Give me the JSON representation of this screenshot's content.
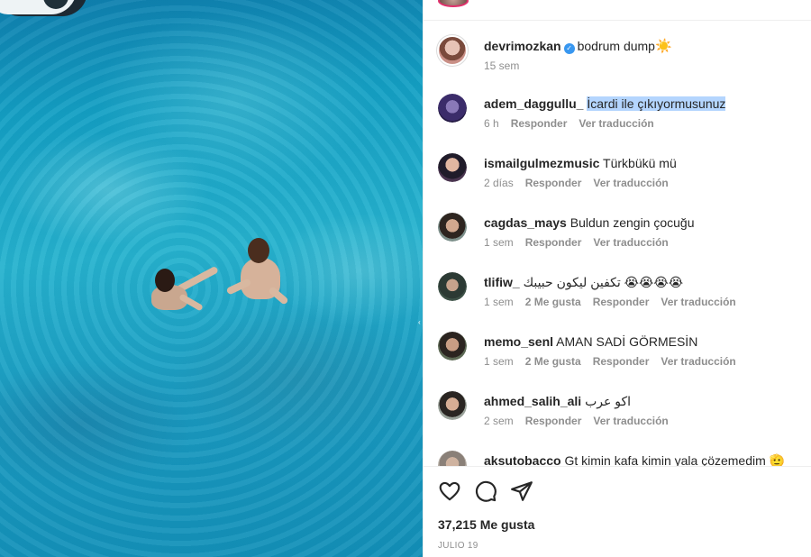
{
  "post": {
    "owner": {
      "username": "devrimozkan",
      "caption": "bodrum dump",
      "caption_emoji": "☀️",
      "age": "15 sem"
    }
  },
  "comments": [
    {
      "username": "adem_daggullu_",
      "text": "İcardi ile çıkıyormusunuz",
      "age": "6 h",
      "likes": "",
      "reply": "Responder",
      "translate": "Ver traducción"
    },
    {
      "username": "ismailgulmezmusic",
      "text": "Türkbükü mü",
      "age": "2 días",
      "likes": "",
      "reply": "Responder",
      "translate": "Ver traducción"
    },
    {
      "username": "cagdas_mays",
      "text": "Buldun zengin çocuğu",
      "age": "1 sem",
      "likes": "",
      "reply": "Responder",
      "translate": "Ver traducción"
    },
    {
      "username": "tlifiw_",
      "text": "تكفين ليكون حبيبك 😭😭😭😭",
      "age": "1 sem",
      "likes": "2 Me gusta",
      "reply": "Responder",
      "translate": "Ver traducción"
    },
    {
      "username": "memo_senl",
      "text": "AMAN SADİ GÖRMESİN",
      "age": "1 sem",
      "likes": "2 Me gusta",
      "reply": "Responder",
      "translate": "Ver traducción"
    },
    {
      "username": "ahmed_salih_ali",
      "text": "اكو عرب",
      "age": "2 sem",
      "likes": "",
      "reply": "Responder",
      "translate": "Ver traducción"
    },
    {
      "username": "aksutobacco",
      "text": "Gt kimin kafa kimin yala çözemedim 🫡",
      "age": "",
      "likes": "",
      "reply": "",
      "translate": ""
    }
  ],
  "footer": {
    "likes_label": "37,215 Me gusta",
    "date": "JULIO 19"
  },
  "icons": [
    "heart-icon",
    "comment-icon",
    "share-icon"
  ],
  "colors": {
    "accent": "#3897f0",
    "highlight": "#b4d5fe",
    "water": "#1a9bc1"
  }
}
